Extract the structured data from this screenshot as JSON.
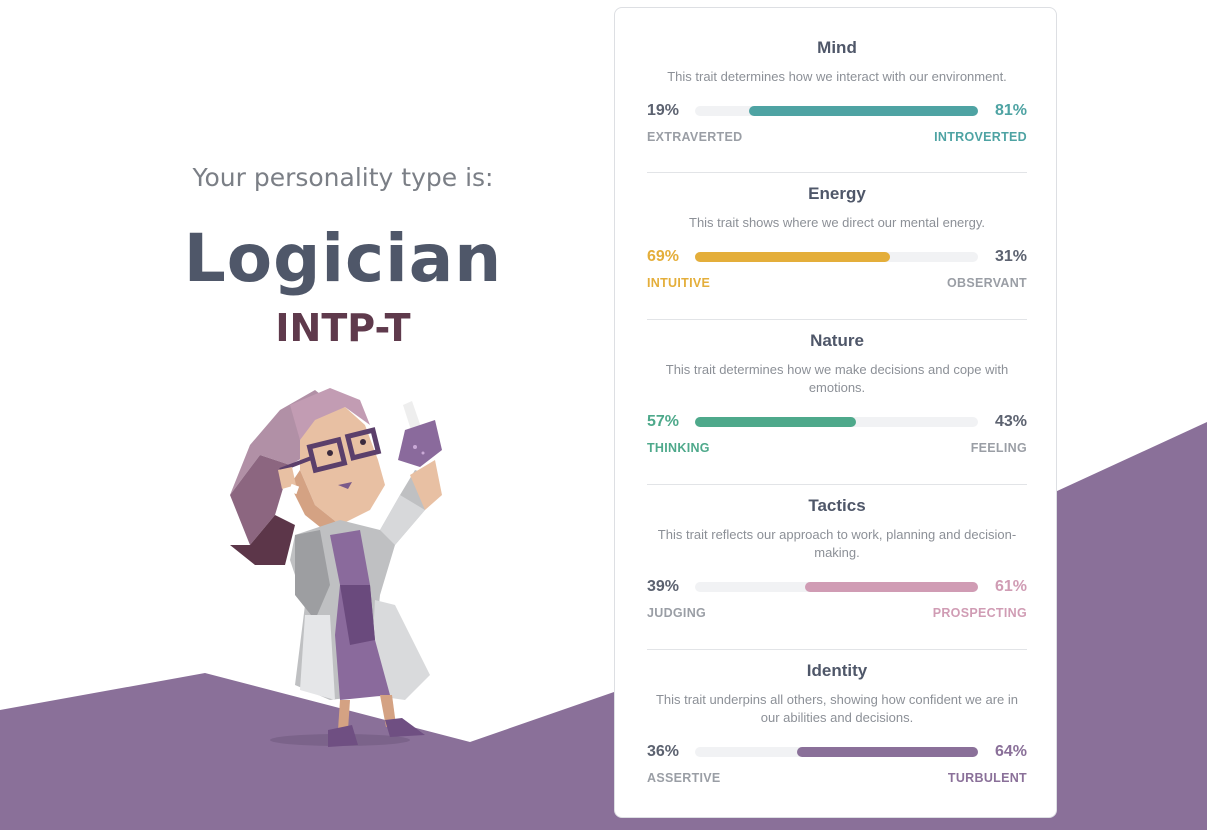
{
  "intro": {
    "label": "Your personality type is:",
    "type_name": "Logician",
    "type_code": "INTP-T"
  },
  "character": {
    "icon": "logician-scientist-illustration"
  },
  "colors": {
    "background_purple": "#8a7099",
    "mind": "#4ea3a3",
    "energy": "#e4ae3a",
    "nature": "#4ea98b",
    "tactics": "#d09cb4",
    "identity": "#8a7099",
    "neutral_text": "#5c6270",
    "neutral_label": "#9a9ea5"
  },
  "traits": [
    {
      "title": "Mind",
      "description": "This trait determines how we interact with our environment.",
      "left_pct": "19%",
      "right_pct": "81%",
      "left_label": "EXTRAVERTED",
      "right_label": "INTROVERTED",
      "dominant": "right",
      "fill_fraction": 0.81,
      "color": "#4ea3a3"
    },
    {
      "title": "Energy",
      "description": "This trait shows where we direct our mental energy.",
      "left_pct": "69%",
      "right_pct": "31%",
      "left_label": "INTUITIVE",
      "right_label": "OBSERVANT",
      "dominant": "left",
      "fill_fraction": 0.69,
      "color": "#e4ae3a"
    },
    {
      "title": "Nature",
      "description": "This trait determines how we make decisions and cope with emotions.",
      "left_pct": "57%",
      "right_pct": "43%",
      "left_label": "THINKING",
      "right_label": "FEELING",
      "dominant": "left",
      "fill_fraction": 0.57,
      "color": "#4ea98b"
    },
    {
      "title": "Tactics",
      "description": "This trait reflects our approach to work, planning and decision-making.",
      "left_pct": "39%",
      "right_pct": "61%",
      "left_label": "JUDGING",
      "right_label": "PROSPECTING",
      "dominant": "right",
      "fill_fraction": 0.61,
      "color": "#d09cb4"
    },
    {
      "title": "Identity",
      "description": "This trait underpins all others, showing how confident we are in our abilities and decisions.",
      "left_pct": "36%",
      "right_pct": "64%",
      "left_label": "ASSERTIVE",
      "right_label": "TURBULENT",
      "dominant": "right",
      "fill_fraction": 0.64,
      "color": "#8a7099"
    }
  ]
}
